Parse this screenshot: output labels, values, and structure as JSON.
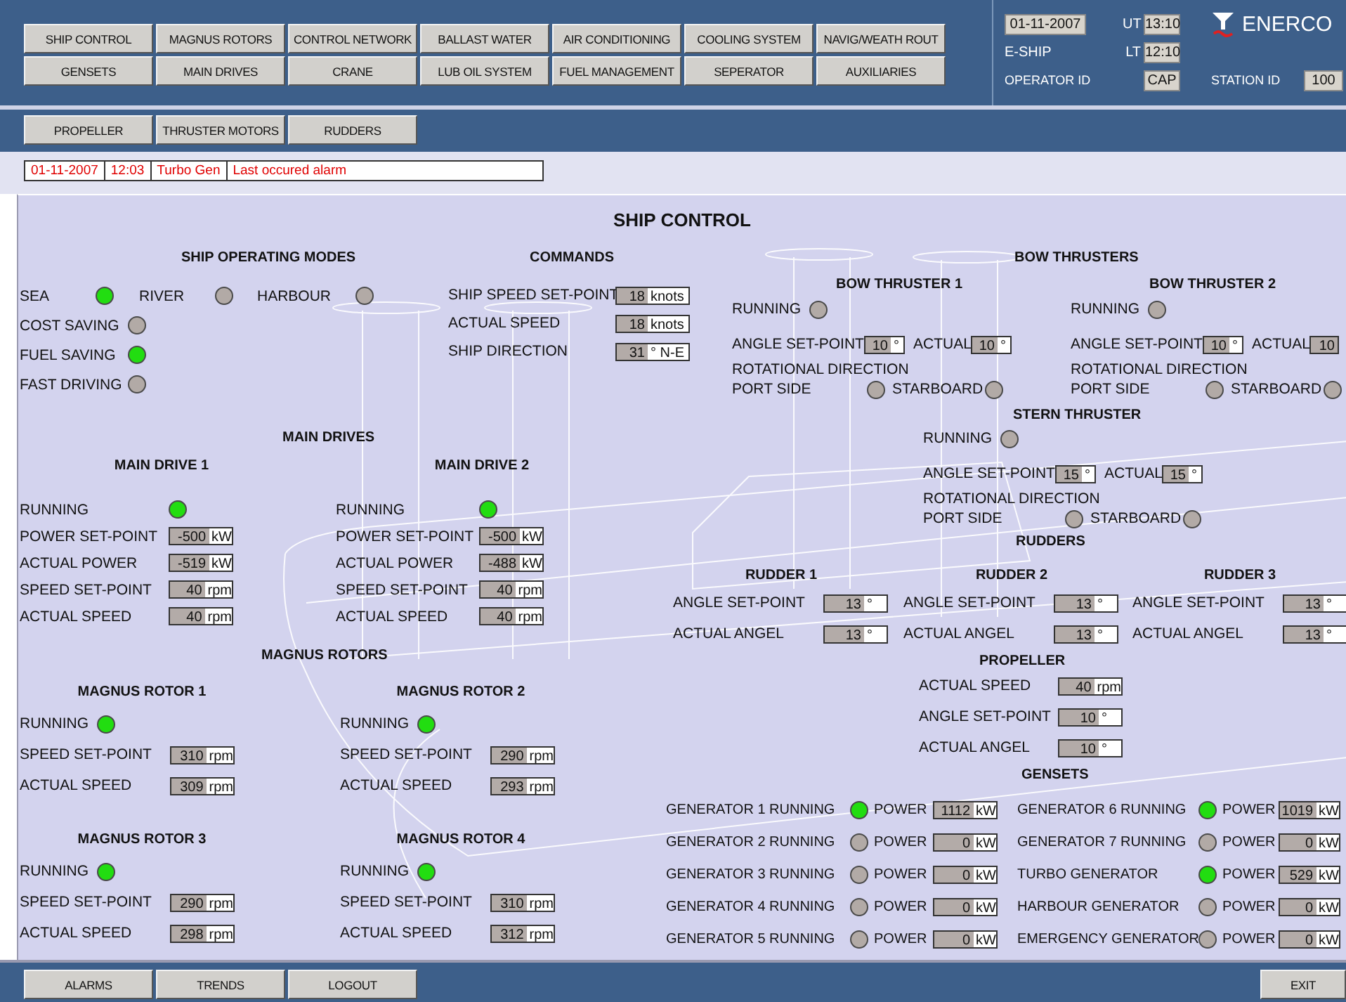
{
  "nav_buttons": [
    [
      "SHIP CONTROL",
      "MAGNUS ROTORS",
      "CONTROL NETWORK",
      "BALLAST WATER",
      "AIR CONDITIONING",
      "COOLING SYSTEM",
      "NAVIG/WEATH ROUT"
    ],
    [
      "GENSETS",
      "MAIN DRIVES",
      "CRANE",
      "LUB OIL SYSTEM",
      "FUEL MANAGEMENT",
      "SEPERATOR",
      "AUXILIARIES"
    ]
  ],
  "header": {
    "date": "01-11-2007",
    "ut_label": "UT",
    "ut": "13:10",
    "ship": "E-SHIP",
    "lt_label": "LT",
    "lt": "12:10",
    "operator_label": "OPERATOR ID",
    "operator": "CAP",
    "station_label": "STATION ID",
    "station": "100",
    "logo": "ENERCO"
  },
  "sub_buttons": [
    "PROPELLER",
    "THRUSTER MOTORS",
    "RUDDERS"
  ],
  "alarm": {
    "date": "01-11-2007",
    "time": "12:03",
    "source": "Turbo Gen",
    "message": "Last occured alarm"
  },
  "title": "SHIP CONTROL",
  "operating_modes": {
    "title": "SHIP OPERATING MODES",
    "row_modes": [
      {
        "label": "SEA",
        "on": true
      },
      {
        "label": "RIVER",
        "on": false
      },
      {
        "label": "HARBOUR",
        "on": false
      }
    ],
    "column_modes": [
      {
        "label": "COST SAVING",
        "on": false
      },
      {
        "label": "FUEL SAVING",
        "on": true
      },
      {
        "label": "FAST DRIVING",
        "on": false
      }
    ]
  },
  "commands": {
    "title": "COMMANDS",
    "rows": [
      {
        "label": "SHIP SPEED SET-POINT",
        "value": "18",
        "unit": "knots"
      },
      {
        "label": "ACTUAL SPEED",
        "value": "18",
        "unit": "knots"
      },
      {
        "label": "SHIP DIRECTION",
        "value": "31",
        "unit": "° N-E"
      }
    ]
  },
  "main_drives": {
    "title": "MAIN DRIVES",
    "drives": [
      {
        "title": "MAIN DRIVE 1",
        "running_label": "RUNNING",
        "running": true,
        "rows": [
          {
            "label": "POWER SET-POINT",
            "value": "-500",
            "unit": "kW"
          },
          {
            "label": "ACTUAL POWER",
            "value": "-519",
            "unit": "kW"
          },
          {
            "label": "SPEED SET-POINT",
            "value": "40",
            "unit": "rpm"
          },
          {
            "label": "ACTUAL SPEED",
            "value": "40",
            "unit": "rpm"
          }
        ]
      },
      {
        "title": "MAIN DRIVE 2",
        "running_label": "RUNNING",
        "running": true,
        "rows": [
          {
            "label": "POWER SET-POINT",
            "value": "-500",
            "unit": "kW"
          },
          {
            "label": "ACTUAL POWER",
            "value": "-488",
            "unit": "kW"
          },
          {
            "label": "SPEED SET-POINT",
            "value": "40",
            "unit": "rpm"
          },
          {
            "label": "ACTUAL SPEED",
            "value": "40",
            "unit": "rpm"
          }
        ]
      }
    ]
  },
  "magnus_rotors": {
    "title": "MAGNUS ROTORS",
    "rotors": [
      {
        "title": "MAGNUS ROTOR 1",
        "running_label": "RUNNING",
        "running": true,
        "rows": [
          {
            "label": "SPEED SET-POINT",
            "value": "310",
            "unit": "rpm"
          },
          {
            "label": "ACTUAL SPEED",
            "value": "309",
            "unit": "rpm"
          }
        ]
      },
      {
        "title": "MAGNUS ROTOR 2",
        "running_label": "RUNNING",
        "running": true,
        "rows": [
          {
            "label": "SPEED SET-POINT",
            "value": "290",
            "unit": "rpm"
          },
          {
            "label": "ACTUAL SPEED",
            "value": "293",
            "unit": "rpm"
          }
        ]
      },
      {
        "title": "MAGNUS ROTOR 3",
        "running_label": "RUNNING",
        "running": true,
        "rows": [
          {
            "label": "SPEED SET-POINT",
            "value": "290",
            "unit": "rpm"
          },
          {
            "label": "ACTUAL SPEED",
            "value": "298",
            "unit": "rpm"
          }
        ]
      },
      {
        "title": "MAGNUS ROTOR 4",
        "running_label": "RUNNING",
        "running": true,
        "rows": [
          {
            "label": "SPEED SET-POINT",
            "value": "310",
            "unit": "rpm"
          },
          {
            "label": "ACTUAL SPEED",
            "value": "312",
            "unit": "rpm"
          }
        ]
      }
    ]
  },
  "bow_thrusters": {
    "title": "BOW THRUSTERS",
    "thrusters": [
      {
        "title": "BOW THRUSTER 1",
        "running_label": "RUNNING",
        "running": false,
        "angle_label": "ANGLE SET-POINT",
        "angle": {
          "value": "10",
          "unit": "°"
        },
        "actual_label": "ACTUAL",
        "actual": {
          "value": "10",
          "unit": "°"
        },
        "direction_label": "ROTATIONAL DIRECTION",
        "port_label": "PORT SIDE",
        "port": false,
        "starboard_label": "STARBOARD",
        "starboard": false
      },
      {
        "title": "BOW THRUSTER 2",
        "running_label": "RUNNING",
        "running": false,
        "angle_label": "ANGLE SET-POINT",
        "angle": {
          "value": "10",
          "unit": "°"
        },
        "actual_label": "ACTUAL",
        "actual": {
          "value": "10"
        },
        "direction_label": "ROTATIONAL DIRECTION",
        "port_label": "PORT SIDE",
        "port": false,
        "starboard_label": "STARBOARD",
        "starboard": false
      }
    ]
  },
  "stern_thruster": {
    "title": "STERN THRUSTER",
    "running_label": "RUNNING",
    "running": false,
    "angle_label": "ANGLE SET-POINT",
    "angle": {
      "value": "15",
      "unit": "°"
    },
    "actual_label": "ACTUAL",
    "actual": {
      "value": "15",
      "unit": "°"
    },
    "direction_label": "ROTATIONAL DIRECTION",
    "port_label": "PORT SIDE",
    "port": false,
    "starboard_label": "STARBOARD",
    "starboard": false
  },
  "rudders": {
    "title": "RUDDERS",
    "rudders": [
      {
        "title": "RUDDER 1",
        "rows": [
          {
            "label": "ANGLE SET-POINT",
            "value": "13",
            "unit": "°"
          },
          {
            "label": "ACTUAL ANGEL",
            "value": "13",
            "unit": "°"
          }
        ]
      },
      {
        "title": "RUDDER 2",
        "rows": [
          {
            "label": "ANGLE SET-POINT",
            "value": "13",
            "unit": "°"
          },
          {
            "label": "ACTUAL ANGEL",
            "value": "13",
            "unit": "°"
          }
        ]
      },
      {
        "title": "RUDDER 3",
        "rows": [
          {
            "label": "ANGLE SET-POINT",
            "value": "13",
            "unit": "°"
          },
          {
            "label": "ACTUAL ANGEL",
            "value": "13",
            "unit": "°"
          }
        ]
      }
    ]
  },
  "propeller": {
    "title": "PROPELLER",
    "rows": [
      {
        "label": "ACTUAL SPEED",
        "value": "40",
        "unit": "rpm"
      },
      {
        "label": "ANGLE SET-POINT",
        "value": "10",
        "unit": "°"
      },
      {
        "label": "ACTUAL ANGEL",
        "value": "10",
        "unit": "°"
      }
    ]
  },
  "gensets": {
    "title": "GENSETS",
    "items": [
      {
        "label": "GENERATOR 1 RUNNING",
        "running": true,
        "power_label": "POWER",
        "value": "1112",
        "unit": "kW"
      },
      {
        "label": "GENERATOR 2 RUNNING",
        "running": false,
        "power_label": "POWER",
        "value": "0",
        "unit": "kW"
      },
      {
        "label": "GENERATOR 3 RUNNING",
        "running": false,
        "power_label": "POWER",
        "value": "0",
        "unit": "kW"
      },
      {
        "label": "GENERATOR 4 RUNNING",
        "running": false,
        "power_label": "POWER",
        "value": "0",
        "unit": "kW"
      },
      {
        "label": "GENERATOR 5 RUNNING",
        "running": false,
        "power_label": "POWER",
        "value": "0",
        "unit": "kW"
      },
      {
        "label": "GENERATOR 6 RUNNING",
        "running": true,
        "power_label": "POWER",
        "value": "1019",
        "unit": "kW"
      },
      {
        "label": "GENERATOR 7 RUNNING",
        "running": false,
        "power_label": "POWER",
        "value": "0",
        "unit": "kW"
      },
      {
        "label": "TURBO GENERATOR",
        "running": true,
        "power_label": "POWER",
        "value": "529",
        "unit": "kW"
      },
      {
        "label": "HARBOUR GENERATOR",
        "running": false,
        "power_label": "POWER",
        "value": "0",
        "unit": "kW"
      },
      {
        "label": "EMERGENCY GENERATOR",
        "running": false,
        "power_label": "POWER",
        "value": "0",
        "unit": "kW"
      }
    ]
  },
  "footer": {
    "buttons": [
      "ALARMS",
      "TRENDS",
      "LOGOUT"
    ],
    "exit": "EXIT"
  }
}
